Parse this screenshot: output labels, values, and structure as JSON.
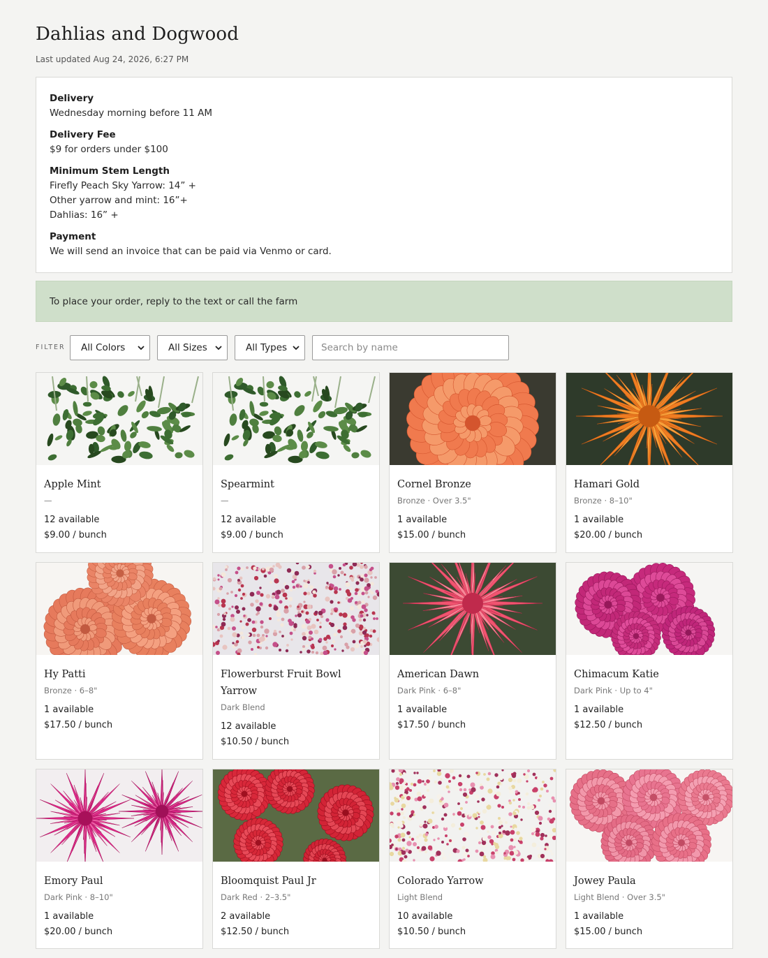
{
  "farm_name": "Dahlias and Dogwood",
  "last_updated": "Last updated Aug 24, 2026, 6:27 PM",
  "info": {
    "delivery_heading": "Delivery",
    "delivery_text": "Wednesday morning before 11 AM",
    "fee_heading": "Delivery Fee",
    "fee_text": "$9 for orders under $100",
    "stem_heading": "Minimum Stem Length",
    "stem_lines": [
      "Firefly Peach Sky Yarrow: 14” +",
      "Other yarrow and mint: 16”+",
      "Dahlias: 16” +"
    ],
    "payment_heading": "Payment",
    "payment_text": "We will send an invoice that can be paid via Venmo or card."
  },
  "banner_text": "To place your order, reply to the text or call the farm",
  "filter": {
    "label": "FILTER",
    "colors_value": "All Colors",
    "sizes_value": "All Sizes",
    "types_value": "All Types",
    "search_placeholder": "Search by name"
  },
  "products": [
    {
      "name": "Apple Mint",
      "meta": "—",
      "available": "12 available",
      "price": "$9.00",
      "unit": "/ bunch",
      "image": "mint-foliage"
    },
    {
      "name": "Spearmint",
      "meta": "—",
      "available": "12 available",
      "price": "$9.00",
      "unit": "/ bunch",
      "image": "mint-foliage"
    },
    {
      "name": "Cornel Bronze",
      "meta": "Bronze · Over 3.5\"",
      "available": "1 available",
      "price": "$15.00",
      "unit": "/ bunch",
      "image": "orange-ball-dahlia"
    },
    {
      "name": "Hamari Gold",
      "meta": "Bronze · 8–10\"",
      "available": "1 available",
      "price": "$20.00",
      "unit": "/ bunch",
      "image": "orange-dinnerplate-dahlia"
    },
    {
      "name": "Hy Patti",
      "meta": "Bronze · 6–8\"",
      "available": "1 available",
      "price": "$17.50",
      "unit": "/ bunch",
      "image": "coral-dahlias"
    },
    {
      "name": "Flowerburst Fruit Bowl Yarrow",
      "meta": "Dark Blend",
      "available": "12 available",
      "price": "$10.50",
      "unit": "/ bunch",
      "image": "yarrow-bouquet"
    },
    {
      "name": "American Dawn",
      "meta": "Dark Pink · 6–8\"",
      "available": "1 available",
      "price": "$17.50",
      "unit": "/ bunch",
      "image": "pink-dahlia"
    },
    {
      "name": "Chimacum Katie",
      "meta": "Dark Pink · Up to 4\"",
      "available": "1 available",
      "price": "$12.50",
      "unit": "/ bunch",
      "image": "magenta-pompom-dahlias"
    },
    {
      "name": "Emory Paul",
      "meta": "Dark Pink · 8–10\"",
      "available": "1 available",
      "price": "$20.00",
      "unit": "/ bunch",
      "image": "magenta-dahlias"
    },
    {
      "name": "Bloomquist Paul Jr",
      "meta": "Dark Red · 2–3.5\"",
      "available": "2 available",
      "price": "$12.50",
      "unit": "/ bunch",
      "image": "red-ball-dahlias"
    },
    {
      "name": "Colorado Yarrow",
      "meta": "Light Blend",
      "available": "10 available",
      "price": "$10.50",
      "unit": "/ bunch",
      "image": "yarrow-mix"
    },
    {
      "name": "Jowey Paula",
      "meta": "Light Blend · Over 3.5\"",
      "available": "1 available",
      "price": "$15.00",
      "unit": "/ bunch",
      "image": "pink-ball-dahlias"
    }
  ],
  "colors": {
    "background": "#f4f4f2",
    "banner": "#cfdfca",
    "card_border": "#d9d9d6"
  }
}
